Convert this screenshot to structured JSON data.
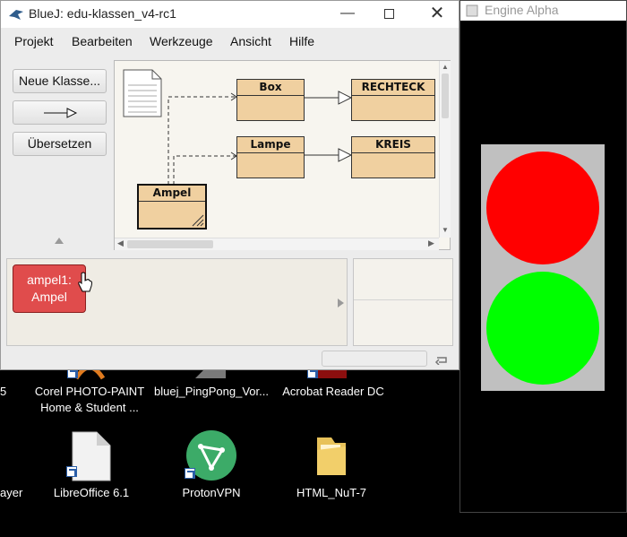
{
  "bluej": {
    "title": "BlueJ:  edu-klassen_v4-rc1",
    "menu": [
      "Projekt",
      "Bearbeiten",
      "Werkzeuge",
      "Ansicht",
      "Hilfe"
    ],
    "buttons": {
      "new_class": "Neue Klasse...",
      "compile": "Übersetzen"
    },
    "classes": {
      "box": "Box",
      "rechteck": "RECHTECK",
      "lampe": "Lampe",
      "kreis": "KREIS",
      "ampel": "Ampel"
    },
    "object": {
      "line1": "ampel1:",
      "line2": "Ampel"
    }
  },
  "engine": {
    "title": "Engine Alpha",
    "lamp_top_color": "#ff0000",
    "lamp_bottom_color": "#00ff00"
  },
  "desktop": {
    "icons": [
      {
        "label_line1": "Corel PHOTO-PAINT",
        "label_line2": "Home & Student ..."
      },
      {
        "label_line1": "bluej_PingPong_Vor..."
      },
      {
        "label_line1": "Acrobat Reader DC"
      },
      {
        "label_line1": "LibreOffice 6.1"
      },
      {
        "label_line1": "ProtonVPN"
      },
      {
        "label_line1": "HTML_NuT-7"
      }
    ],
    "partial_left_top": "5",
    "partial_left_bottom": "ayer"
  }
}
